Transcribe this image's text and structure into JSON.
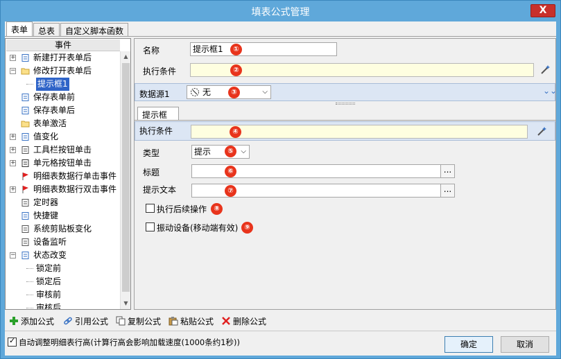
{
  "window": {
    "title": "填表公式管理",
    "close_label": "X"
  },
  "tabs": [
    {
      "label": "表单",
      "active": true
    },
    {
      "label": "总表",
      "active": false
    },
    {
      "label": "自定义脚本函数",
      "active": false
    }
  ],
  "tree": {
    "header": "事件",
    "items": [
      {
        "label": "新建打开表单后",
        "icon": "new-form-icon",
        "expander": "+"
      },
      {
        "label": "修改打开表单后",
        "icon": "folder-open-icon",
        "expander": "-"
      },
      {
        "label": "提示框1",
        "icon": "",
        "expander": "",
        "selected": true
      },
      {
        "label": "保存表单前",
        "icon": "save-before-icon",
        "expander": ""
      },
      {
        "label": "保存表单后",
        "icon": "save-after-icon",
        "expander": ""
      },
      {
        "label": "表单激活",
        "icon": "folder-icon",
        "expander": ""
      },
      {
        "label": "值变化",
        "icon": "value-change-icon",
        "expander": "+"
      },
      {
        "label": "工具栏按钮单击",
        "icon": "toolbar-click-icon",
        "expander": "+"
      },
      {
        "label": "单元格按钮单击",
        "icon": "cell-button-icon",
        "expander": "+"
      },
      {
        "label": "明细表数据行单击事件",
        "icon": "flag-icon",
        "expander": ""
      },
      {
        "label": "明细表数据行双击事件",
        "icon": "flag-icon",
        "expander": "+"
      },
      {
        "label": "定时器",
        "icon": "timer-icon",
        "expander": ""
      },
      {
        "label": "快捷键",
        "icon": "shortcut-icon",
        "expander": ""
      },
      {
        "label": "系统剪贴板变化",
        "icon": "scissors-icon",
        "expander": ""
      },
      {
        "label": "设备监听",
        "icon": "device-icon",
        "expander": ""
      },
      {
        "label": "状态改变",
        "icon": "state-icon",
        "expander": "-"
      },
      {
        "label": "锁定前",
        "icon": "",
        "expander": ""
      },
      {
        "label": "锁定后",
        "icon": "",
        "expander": ""
      },
      {
        "label": "审核前",
        "icon": "",
        "expander": ""
      },
      {
        "label": "审核后",
        "icon": "",
        "expander": ""
      }
    ]
  },
  "form": {
    "name_label": "名称",
    "name_value": "提示框1",
    "condition_label": "执行条件",
    "condition_value": "",
    "datasource_label": "数据源1",
    "datasource_value": "无",
    "subtab_label": "提示框",
    "sub_condition_label": "执行条件",
    "sub_condition_value": "",
    "type_label": "类型",
    "type_value": "提示",
    "title_label": "标题",
    "title_value": "",
    "prompt_label": "提示文本",
    "prompt_value": "",
    "dots_label": "...",
    "continue_label": "执行后续操作",
    "continue_checked": false,
    "vibrate_label": "振动设备(移动端有效)",
    "vibrate_checked": false,
    "markers": [
      "①",
      "②",
      "③",
      "④",
      "⑤",
      "⑥",
      "⑦",
      "⑧",
      "⑨"
    ]
  },
  "toolbar": {
    "add": "添加公式",
    "ref": "引用公式",
    "copy": "复制公式",
    "paste": "粘贴公式",
    "delete": "删除公式"
  },
  "footer": {
    "auto_adjust_label": "自动调整明细表行高(计算行高会影响加载速度(1000条约1秒))",
    "auto_adjust_checked": true,
    "ok": "确定",
    "cancel": "取消"
  },
  "colors": {
    "title_bar": "#5fa8da",
    "close": "#c8302b",
    "selection": "#2f64c8",
    "marker": "#e8341c",
    "highlight_field": "#fefee0"
  }
}
